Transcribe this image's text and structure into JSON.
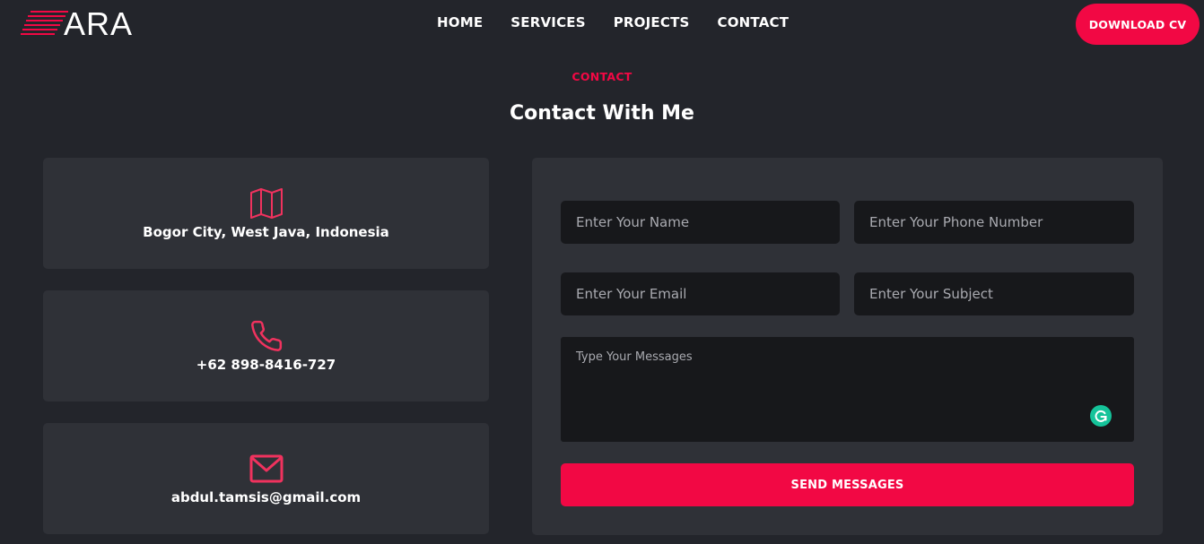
{
  "header": {
    "logo_text": "ARA",
    "nav": [
      "HOME",
      "SERVICES",
      "PROJECTS",
      "CONTACT"
    ],
    "cta_label": "DOWNLOAD CV"
  },
  "section": {
    "eyebrow": "CONTACT",
    "title": "Contact With Me"
  },
  "info": {
    "address": "Bogor City, West Java, Indonesia",
    "phone": "+62 898-8416-727",
    "email": "abdul.tamsis@gmail.com"
  },
  "form": {
    "name_placeholder": "Enter Your Name",
    "phone_placeholder": "Enter Your Phone Number",
    "email_placeholder": "Enter Your Email",
    "subject_placeholder": "Enter Your Subject",
    "message_placeholder": "Type Your Messages",
    "submit_label": "SEND MESSAGES"
  },
  "icons": {
    "address": "map-icon",
    "phone": "phone-icon",
    "email": "mail-icon",
    "grammarly": "grammarly-icon"
  },
  "colors": {
    "accent": "#f20844",
    "background": "#23252b",
    "card": "#2f3137",
    "input": "#17181b",
    "grammarly": "#15c39a"
  }
}
